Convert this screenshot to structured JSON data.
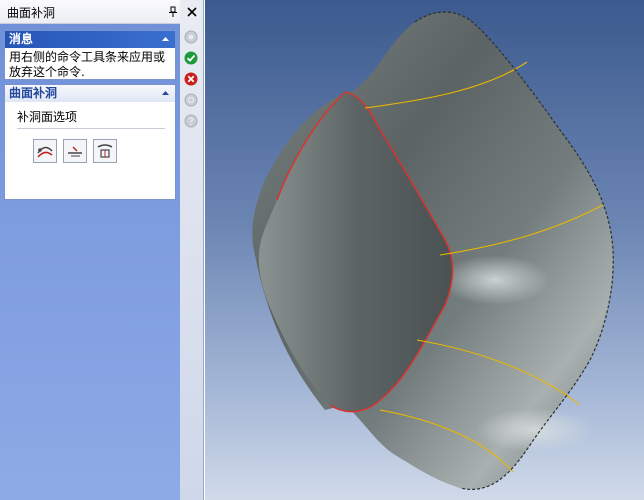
{
  "panel": {
    "title": "曲面补洞",
    "message_group": {
      "header": "消息",
      "text": "用右侧的命令工具条来应用或放弃这个命令."
    },
    "surface_group": {
      "header": "曲面补洞",
      "options_label": "补洞面选项",
      "tools": [
        "fill-surface-tool-icon",
        "edge-tool-icon",
        "patch-tool-icon"
      ]
    }
  },
  "confirm_strip": {
    "buttons": [
      "previous-icon",
      "apply-icon",
      "cancel-icon",
      "preview-icon",
      "help-icon"
    ]
  },
  "colors": {
    "panel_bg": "#7f9ee0",
    "group_header": "#2655b8",
    "edge_boundary": "#e0302a",
    "edge_seam": "#e8b800",
    "surface": "#5f6768"
  }
}
